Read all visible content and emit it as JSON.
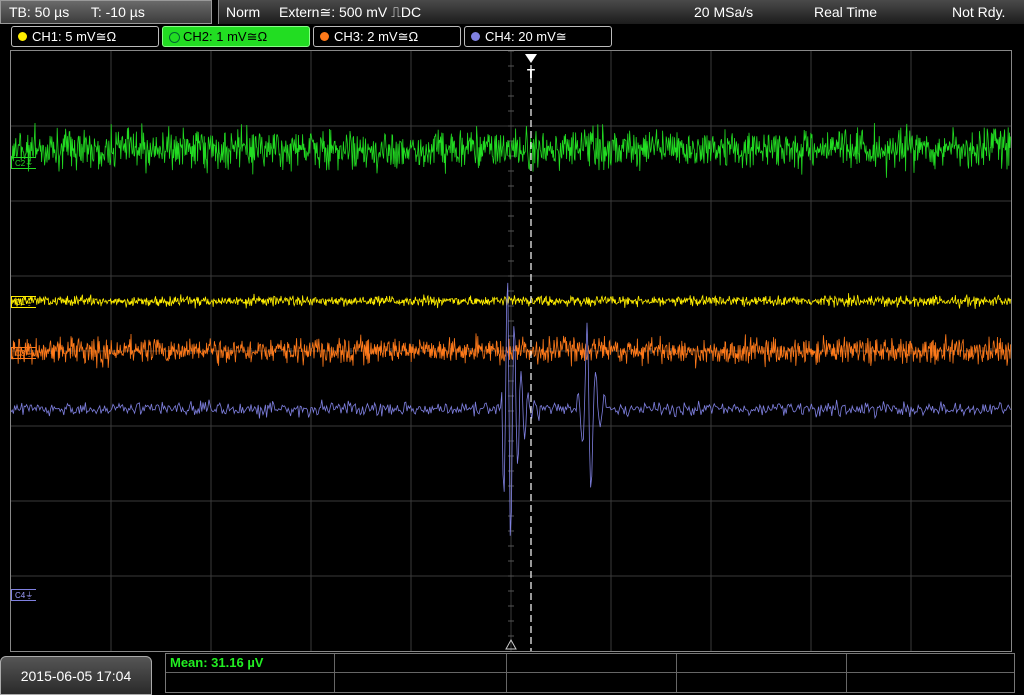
{
  "topbar": {
    "timebase": "TB: 50 µs",
    "trigger_time": "T: -10 µs",
    "mode": "Norm",
    "trigger_source": "Extern≅: 500 mV ⎍DC",
    "sample_rate": "20 MSa/s",
    "acq_mode": "Real Time",
    "status": "Not Rdy."
  },
  "channels": [
    {
      "label": "CH1: 5 mV≅Ω",
      "color": "#ffee00",
      "active": false
    },
    {
      "label": "CH2: 1 mV≅Ω",
      "color": "#22dd22",
      "active": true
    },
    {
      "label": "CH3: 2 mV≅Ω",
      "color": "#ff7a1a",
      "active": false
    },
    {
      "label": "CH4: 20 mV≅",
      "color": "#7f80e0",
      "active": false
    }
  ],
  "markers": {
    "c2": "C2⏚",
    "c1": "C1⏚",
    "c3": "C3⏚",
    "c4": "C4⏚",
    "trigger": "T"
  },
  "measurement": {
    "mean": "Mean: 31.16 µV"
  },
  "footer": {
    "datetime": "2015-06-05 17:04"
  },
  "colors": {
    "ch1": "#ffee00",
    "ch2": "#22dd22",
    "ch3": "#ff7a1a",
    "ch4": "#7f80e0",
    "grid": "#3a3a3a"
  }
}
